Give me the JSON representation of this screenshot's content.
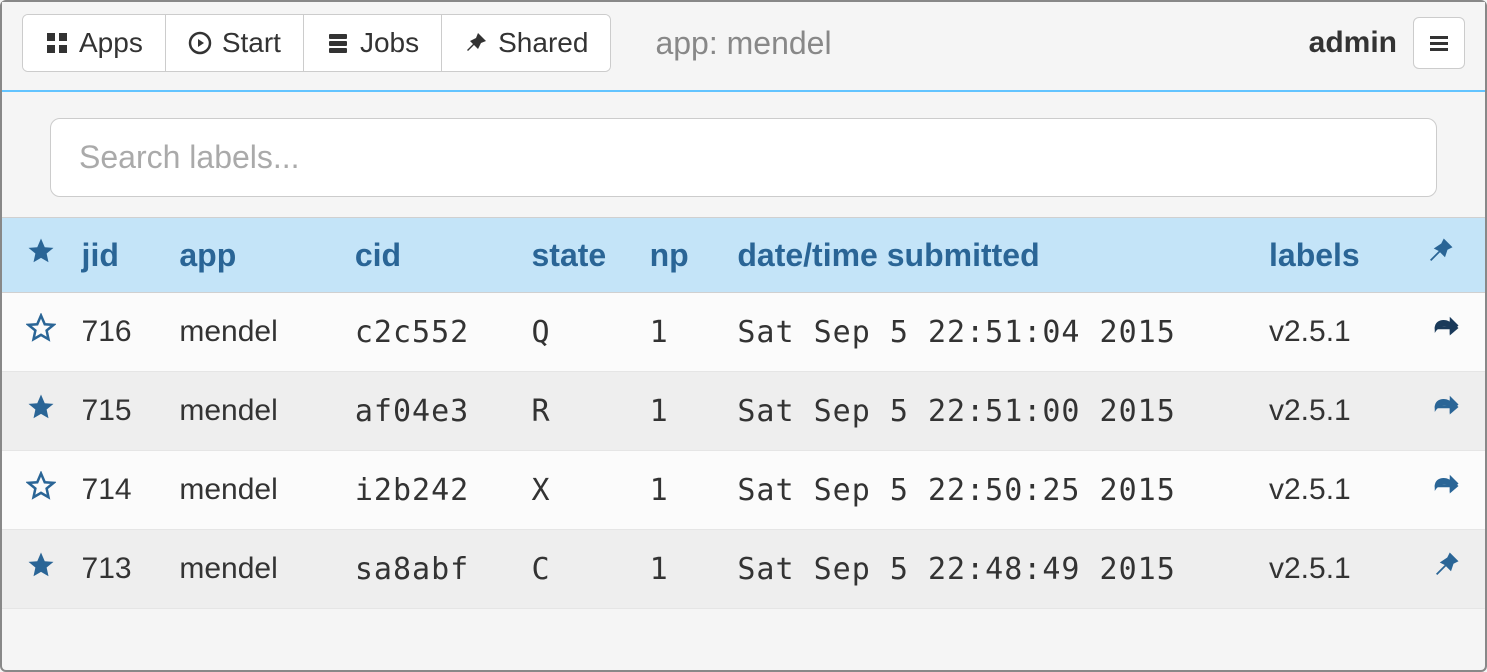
{
  "navbar": {
    "buttons": [
      {
        "label": "Apps",
        "icon": "grid-icon"
      },
      {
        "label": "Start",
        "icon": "play-circle-icon"
      },
      {
        "label": "Jobs",
        "icon": "server-icon"
      },
      {
        "label": "Shared",
        "icon": "pin-icon"
      }
    ],
    "app_title": "app: mendel",
    "username": "admin"
  },
  "search": {
    "placeholder": "Search labels..."
  },
  "table": {
    "headers": {
      "jid": "jid",
      "app": "app",
      "cid": "cid",
      "state": "state",
      "np": "np",
      "date": "date/time submitted",
      "labels": "labels"
    },
    "rows": [
      {
        "starred": false,
        "jid": "716",
        "app": "mendel",
        "cid": "c2c552",
        "state": "Q",
        "np": "1",
        "date": "Sat Sep 5 22:51:04 2015",
        "labels": "v2.5.1",
        "action": "share"
      },
      {
        "starred": true,
        "jid": "715",
        "app": "mendel",
        "cid": "af04e3",
        "state": "R",
        "np": "1",
        "date": "Sat Sep 5 22:51:00 2015",
        "labels": "v2.5.1",
        "action": "share"
      },
      {
        "starred": false,
        "jid": "714",
        "app": "mendel",
        "cid": "i2b242",
        "state": "X",
        "np": "1",
        "date": "Sat Sep 5 22:50:25 2015",
        "labels": "v2.5.1",
        "action": "share"
      },
      {
        "starred": true,
        "jid": "713",
        "app": "mendel",
        "cid": "sa8abf",
        "state": "C",
        "np": "1",
        "date": "Sat Sep 5 22:48:49 2015",
        "labels": "v2.5.1",
        "action": "pin"
      }
    ]
  }
}
